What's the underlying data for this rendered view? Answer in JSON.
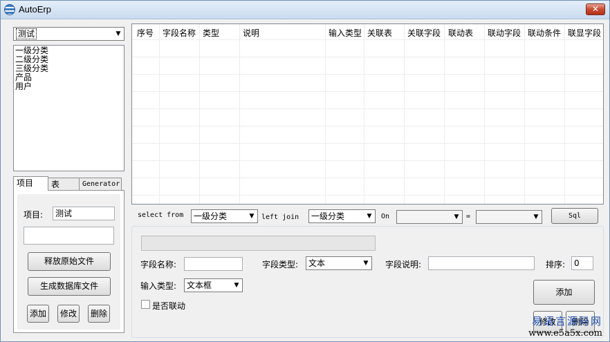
{
  "window": {
    "title": "AutoErp",
    "close_glyph": "✕"
  },
  "project_select": {
    "value": "测试"
  },
  "category_list": {
    "items": [
      "一级分类",
      "二级分类",
      "三级分类",
      "产品",
      "用户"
    ]
  },
  "tabs": [
    {
      "label": "项目"
    },
    {
      "label": "表"
    },
    {
      "label": "Generator"
    }
  ],
  "project_panel": {
    "project_label": "项目:",
    "project_value": "测试",
    "release_button": "释放原始文件",
    "generate_db_button": "生成数据库文件",
    "add_button": "添加",
    "edit_button": "修改",
    "delete_button": "删除"
  },
  "grid": {
    "columns": [
      "序号",
      "字段名称",
      "类型",
      "说明",
      "输入类型",
      "关联表",
      "关联字段",
      "联动表",
      "联动字段",
      "联动条件",
      "联显字段"
    ],
    "rows": []
  },
  "sql_bar": {
    "select_from_label": "select from",
    "select_from_value": "一级分类",
    "left_join_label": "left join",
    "left_join_value": "一级分类",
    "on_label": "On",
    "on_left_value": "",
    "equals_label": "=",
    "on_right_value": "",
    "sql_button": "Sql"
  },
  "field_form": {
    "field_name_label": "字段名称:",
    "field_name_value": "",
    "field_type_label": "字段类型:",
    "field_type_value": "文本",
    "field_desc_label": "字段说明:",
    "field_desc_value": "",
    "sort_label": "排序:",
    "sort_value": "0",
    "input_type_label": "输入类型:",
    "input_type_value": "文本框",
    "linked_label": "是否联动",
    "add_button": "添加",
    "edit_button": "修改",
    "delete_button": "删除"
  },
  "watermark": {
    "cn": "易语言源码网",
    "url": "www.e5a5x.com"
  }
}
